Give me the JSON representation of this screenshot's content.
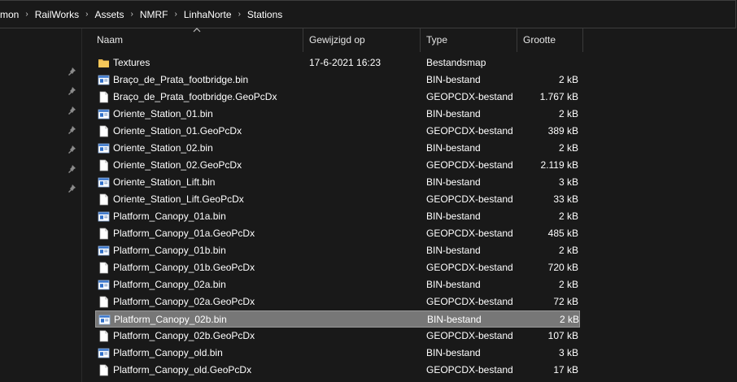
{
  "breadcrumb": [
    "mmon",
    "RailWorks",
    "Assets",
    "NMRF",
    "LinhaNorte",
    "Stations"
  ],
  "columns": {
    "name": "Naam",
    "modified": "Gewijzigd op",
    "type": "Type",
    "size": "Grootte"
  },
  "files": [
    {
      "name": "Textures",
      "modified": "17-6-2021 16:23",
      "type": "Bestandsmap",
      "size": "",
      "icon": "folder-icon"
    },
    {
      "name": "Braço_de_Prata_footbridge.bin",
      "modified": "",
      "type": "BIN-bestand",
      "size": "2 kB",
      "icon": "bin-file-icon"
    },
    {
      "name": "Braço_de_Prata_footbridge.GeoPcDx",
      "modified": "",
      "type": "GEOPCDX-bestand",
      "size": "1.767 kB",
      "icon": "blank-file-icon"
    },
    {
      "name": "Oriente_Station_01.bin",
      "modified": "",
      "type": "BIN-bestand",
      "size": "2 kB",
      "icon": "bin-file-icon"
    },
    {
      "name": "Oriente_Station_01.GeoPcDx",
      "modified": "",
      "type": "GEOPCDX-bestand",
      "size": "389 kB",
      "icon": "blank-file-icon"
    },
    {
      "name": "Oriente_Station_02.bin",
      "modified": "",
      "type": "BIN-bestand",
      "size": "2 kB",
      "icon": "bin-file-icon"
    },
    {
      "name": "Oriente_Station_02.GeoPcDx",
      "modified": "",
      "type": "GEOPCDX-bestand",
      "size": "2.119 kB",
      "icon": "blank-file-icon"
    },
    {
      "name": "Oriente_Station_Lift.bin",
      "modified": "",
      "type": "BIN-bestand",
      "size": "3 kB",
      "icon": "bin-file-icon"
    },
    {
      "name": "Oriente_Station_Lift.GeoPcDx",
      "modified": "",
      "type": "GEOPCDX-bestand",
      "size": "33 kB",
      "icon": "blank-file-icon"
    },
    {
      "name": "Platform_Canopy_01a.bin",
      "modified": "",
      "type": "BIN-bestand",
      "size": "2 kB",
      "icon": "bin-file-icon"
    },
    {
      "name": "Platform_Canopy_01a.GeoPcDx",
      "modified": "",
      "type": "GEOPCDX-bestand",
      "size": "485 kB",
      "icon": "blank-file-icon"
    },
    {
      "name": "Platform_Canopy_01b.bin",
      "modified": "",
      "type": "BIN-bestand",
      "size": "2 kB",
      "icon": "bin-file-icon"
    },
    {
      "name": "Platform_Canopy_01b.GeoPcDx",
      "modified": "",
      "type": "GEOPCDX-bestand",
      "size": "720 kB",
      "icon": "blank-file-icon"
    },
    {
      "name": "Platform_Canopy_02a.bin",
      "modified": "",
      "type": "BIN-bestand",
      "size": "2 kB",
      "icon": "bin-file-icon"
    },
    {
      "name": "Platform_Canopy_02a.GeoPcDx",
      "modified": "",
      "type": "GEOPCDX-bestand",
      "size": "72 kB",
      "icon": "blank-file-icon"
    },
    {
      "name": "Platform_Canopy_02b.bin",
      "modified": "",
      "type": "BIN-bestand",
      "size": "2 kB",
      "icon": "bin-file-icon",
      "selected": true
    },
    {
      "name": "Platform_Canopy_02b.GeoPcDx",
      "modified": "",
      "type": "GEOPCDX-bestand",
      "size": "107 kB",
      "icon": "blank-file-icon"
    },
    {
      "name": "Platform_Canopy_old.bin",
      "modified": "",
      "type": "BIN-bestand",
      "size": "3 kB",
      "icon": "bin-file-icon"
    },
    {
      "name": "Platform_Canopy_old.GeoPcDx",
      "modified": "",
      "type": "GEOPCDX-bestand",
      "size": "17 kB",
      "icon": "blank-file-icon"
    }
  ],
  "pinned_count": 7,
  "colors": {
    "background": "#191919",
    "selection": "#777777",
    "folder": "#e8b64c",
    "bin_icon_accent": "#2f6fc9"
  }
}
